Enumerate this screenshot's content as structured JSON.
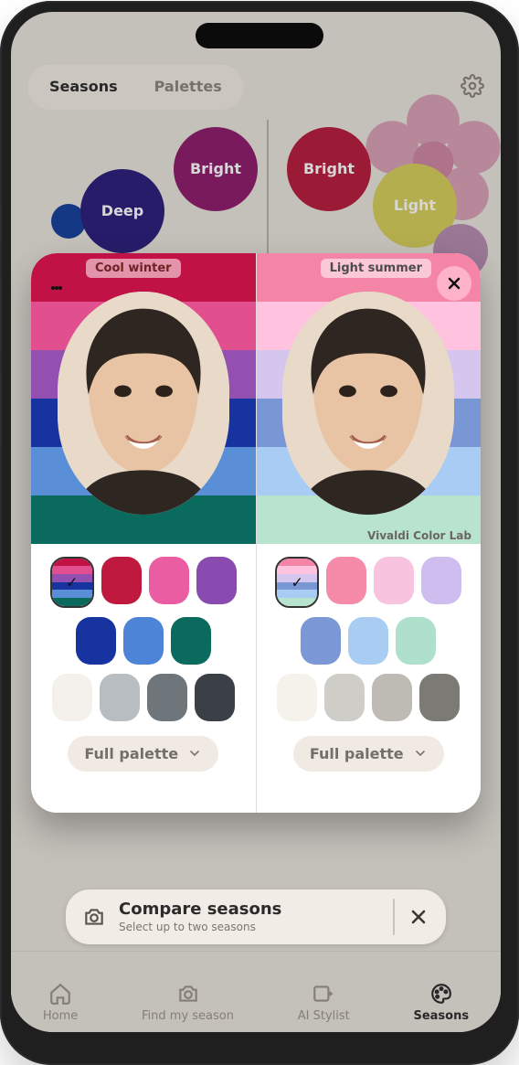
{
  "tabs": [
    "Seasons",
    "Palettes"
  ],
  "bubbles": {
    "deep": "Deep",
    "bright_left": "Bright",
    "bright_right": "Bright",
    "light": "Light"
  },
  "modal": {
    "watermark": "Vivaldi Color Lab",
    "left": {
      "label": "Cool winter",
      "palette_btn": "Full palette",
      "stripes": [
        "#c11245",
        "#e24f8f",
        "#9350b0",
        "#1633a0",
        "#5a8fd8",
        "#0a6a5d"
      ],
      "swatches": [
        "multi",
        "#c0193f",
        "#ea5da3",
        "#8a4bb0",
        "#1633a0",
        "#4d84d7",
        "#0a6a5d",
        "#f4f1ec",
        "#b8bdc2",
        "#6e757b",
        "#3a4045"
      ],
      "selected_swatch_index": 0
    },
    "right": {
      "label": "Light summer",
      "palette_btn": "Full palette",
      "stripes": [
        "#f585a6",
        "#ffc2df",
        "#d5c6f0",
        "#7a97d5",
        "#a8ccf3",
        "#b7e3cf"
      ],
      "swatches": [
        "multi",
        "#f58aa9",
        "#f8c3de",
        "#cfbdef",
        "#7c97d6",
        "#a9ccf3",
        "#aee0cb",
        "#f5f2ec",
        "#cfcdc7",
        "#bdbbb4",
        "#7b7a74"
      ],
      "selected_swatch_index": 0
    }
  },
  "compare": {
    "title": "Compare seasons",
    "subtitle": "Select up to two seasons"
  },
  "nav": [
    "Home",
    "Find my season",
    "AI Stylist",
    "Seasons"
  ],
  "nav_active_index": 3
}
